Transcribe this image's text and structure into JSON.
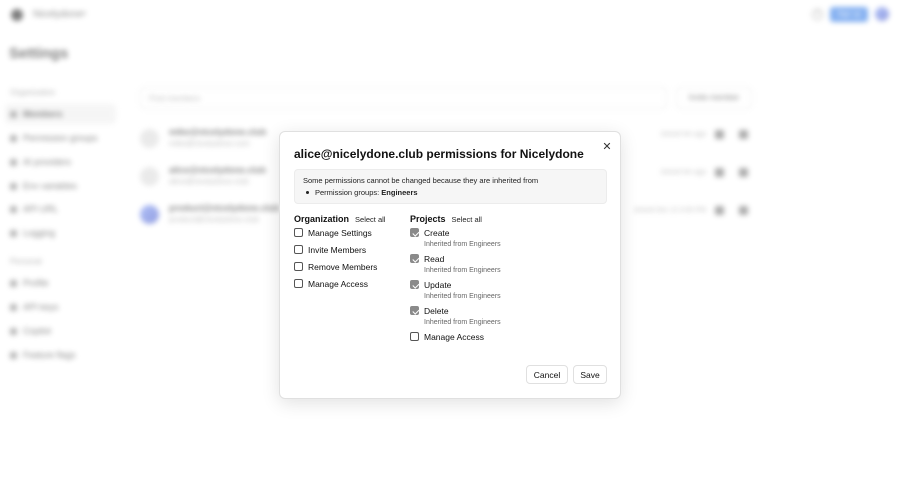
{
  "topbar": {
    "org_name": "Nicelydone",
    "signup_label": "Sign up"
  },
  "page": {
    "title": "Settings"
  },
  "sidebar": {
    "sections": [
      {
        "label": "Organization"
      },
      {
        "label": "Personal"
      }
    ],
    "org_items": [
      {
        "label": "Members",
        "active": true
      },
      {
        "label": "Permission groups"
      },
      {
        "label": "AI providers"
      },
      {
        "label": "Env variables"
      },
      {
        "label": "API URL"
      },
      {
        "label": "Logging"
      }
    ],
    "personal_items": [
      {
        "label": "Profile"
      },
      {
        "label": "API keys"
      },
      {
        "label": "Copilot"
      },
      {
        "label": "Feature flags"
      }
    ]
  },
  "members": {
    "search_placeholder": "Find members",
    "invite_label": "Invite member",
    "rows": [
      {
        "name": "mike@nicelydone.club",
        "email": "mike@nicelydone.com",
        "joined": "Joined 4m ago"
      },
      {
        "name": "alice@nicelydone.club",
        "email": "alice@nicelydone.club",
        "joined": "Joined 4m ago"
      },
      {
        "name": "product@nicelydone.club",
        "email": "product@nicelydone.club",
        "joined": "Joined Dec 12 4:00 PM"
      }
    ]
  },
  "modal": {
    "title": "alice@nicelydone.club permissions for Nicelydone",
    "notice_text": "Some permissions cannot be changed because they are inherited from",
    "notice_groups_prefix": "Permission groups: ",
    "notice_groups_value": "Engineers",
    "organization": {
      "title": "Organization",
      "select_all": "Select all",
      "perms": [
        {
          "label": "Manage Settings",
          "checked": false
        },
        {
          "label": "Invite Members",
          "checked": false
        },
        {
          "label": "Remove Members",
          "checked": false
        },
        {
          "label": "Manage Access",
          "checked": false
        }
      ]
    },
    "projects": {
      "title": "Projects",
      "select_all": "Select all",
      "perms": [
        {
          "label": "Create",
          "checked": true,
          "sub": "Inherited from Engineers"
        },
        {
          "label": "Read",
          "checked": true,
          "sub": "Inherited from Engineers"
        },
        {
          "label": "Update",
          "checked": true,
          "sub": "Inherited from Engineers"
        },
        {
          "label": "Delete",
          "checked": true,
          "sub": "Inherited from Engineers"
        },
        {
          "label": "Manage Access",
          "checked": false
        }
      ]
    },
    "cancel_label": "Cancel",
    "save_label": "Save"
  }
}
